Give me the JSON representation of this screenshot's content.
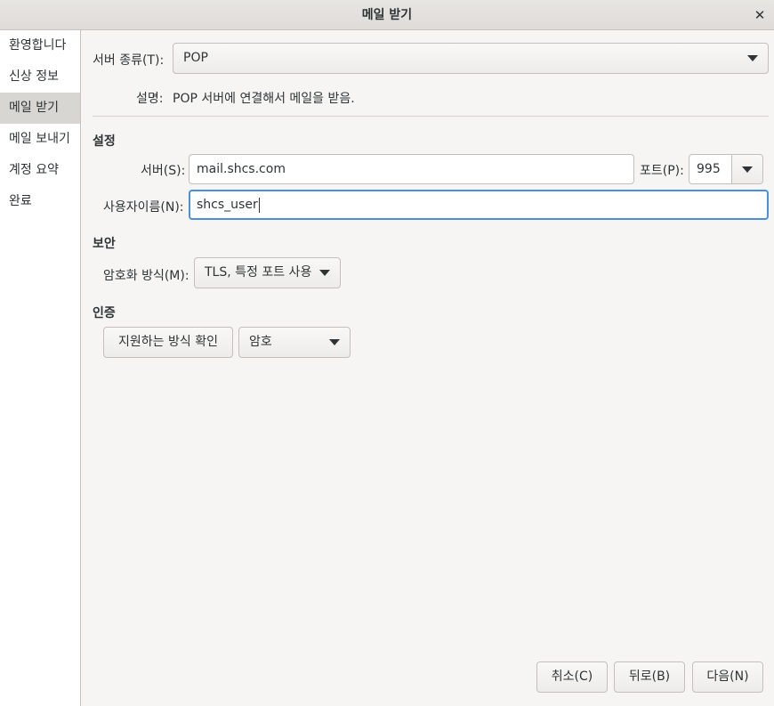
{
  "window": {
    "title": "메일 받기",
    "close_glyph": "✕"
  },
  "sidebar": {
    "items": [
      {
        "label": "환영합니다"
      },
      {
        "label": "신상 정보"
      },
      {
        "label": "메일 받기",
        "active": true
      },
      {
        "label": "메일 보내기"
      },
      {
        "label": "계정 요약"
      },
      {
        "label": "완료"
      }
    ]
  },
  "server_type": {
    "label": "서버 종류(T):",
    "value": "POP"
  },
  "description": {
    "label": "설명:",
    "text": "POP 서버에 연결해서 메일을 받음."
  },
  "settings": {
    "heading": "설정",
    "server_label": "서버(S):",
    "server_value": "mail.shcs.com",
    "port_label": "포트(P):",
    "port_value": "995",
    "username_label": "사용자이름(N):",
    "username_value": "shcs_user"
  },
  "security": {
    "heading": "보안",
    "encryption_label": "암호화 방식(M):",
    "encryption_value": "TLS, 특정 포트 사용"
  },
  "auth": {
    "heading": "인증",
    "check_button": "지원하는 방식 확인",
    "method_value": "암호"
  },
  "footer": {
    "cancel": "취소(C)",
    "back": "뒤로(B)",
    "next": "다음(N)"
  },
  "colors": {
    "focus_border": "#4a90d9",
    "sidebar_active": "#d8d6d3"
  },
  "icons": {
    "dropdown": "chevron-down-icon",
    "close": "close-icon"
  }
}
